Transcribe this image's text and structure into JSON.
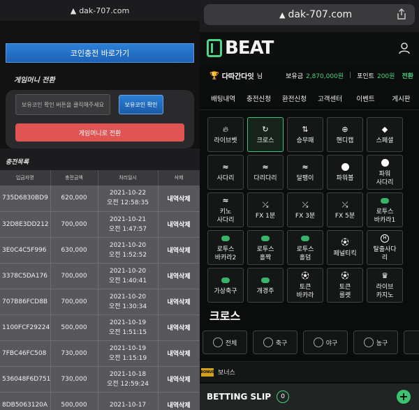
{
  "left": {
    "url": "dak-707.com",
    "coin_button": "코인충전 바로가기",
    "section_title": "게임머니 전환",
    "input_placeholder": "보유코인 확인 버튼을 클릭해주세요",
    "check_button": "보유코인 확인",
    "convert_button": "게임머니로 전환",
    "list_title": "충전목록",
    "columns": [
      "입금자명",
      "충전금액",
      "처리일시",
      "삭제"
    ],
    "rows": [
      {
        "id": "735D6830BD9",
        "amount": "620,000",
        "date": "2021-10-22",
        "time": "오전 12:58:35",
        "del": "내역삭제"
      },
      {
        "id": "32D8E3DD212",
        "amount": "700,000",
        "date": "2021-10-21",
        "time": "오전 1:47:57",
        "del": "내역삭제"
      },
      {
        "id": "3E0C4C5F996",
        "amount": "630,000",
        "date": "2021-10-20",
        "time": "오전 1:52:52",
        "del": "내역삭제"
      },
      {
        "id": "3378C5DA176",
        "amount": "700,000",
        "date": "2021-10-20",
        "time": "오전 1:40:41",
        "del": "내역삭제"
      },
      {
        "id": "707B86FCD8B",
        "amount": "700,000",
        "date": "2021-10-20",
        "time": "오전 1:30:34",
        "del": "내역삭제"
      },
      {
        "id": "1100FCF29224",
        "amount": "500,000",
        "date": "2021-10-19",
        "time": "오전 1:51:15",
        "del": "내역삭제"
      },
      {
        "id": "7FBC46FC508",
        "amount": "730,000",
        "date": "2021-10-19",
        "time": "오전 1:15:19",
        "del": "내역삭제"
      },
      {
        "id": "536048F6D751",
        "amount": "730,000",
        "date": "2021-10-18",
        "time": "오전 12:59:24",
        "del": "내역삭제"
      },
      {
        "id": "8DB5063120A",
        "amount": "500,000",
        "date": "2021-10-17",
        "time": "",
        "del": "내역삭제"
      }
    ]
  },
  "right": {
    "url": "dak-707.com",
    "logo_text": "BEAT",
    "user": {
      "name": "다따간다잇",
      "suffix": "님",
      "balance_label": "보유금",
      "balance": "2,870,000원",
      "points_label": "포인트",
      "points": "200원",
      "convert": "전환"
    },
    "tabs": [
      "배팅내역",
      "충전신청",
      "환전신청",
      "고객센터",
      "이벤트",
      "게시판"
    ],
    "games": [
      {
        "label": "라이브벳",
        "icon": "fire-icon"
      },
      {
        "label": "크로스",
        "icon": "refresh-icon"
      },
      {
        "label": "승무패",
        "icon": "arrows-icon"
      },
      {
        "label": "핸디캡",
        "icon": "plus-circle-icon"
      },
      {
        "label": "스페셜",
        "icon": "tag-icon"
      },
      {
        "label": "사다리",
        "icon": "ladder-icon"
      },
      {
        "label": "다리다리",
        "icon": "ladder-icon"
      },
      {
        "label": "달팽이",
        "icon": "ladder-icon"
      },
      {
        "label": "파워볼",
        "icon": "ball-icon"
      },
      {
        "label": "파워\n사다리",
        "icon": "ball-icon"
      },
      {
        "label": "키노\n사다리",
        "icon": "ladder-icon"
      },
      {
        "label": "FX 1분",
        "icon": "chart-icon"
      },
      {
        "label": "FX 3분",
        "icon": "chart-icon"
      },
      {
        "label": "FX 5분",
        "icon": "chart-icon"
      },
      {
        "label": "로투스\n바카라1",
        "icon": "green-ball-icon"
      },
      {
        "label": "로투스\n바카라2",
        "icon": "green-ball-icon"
      },
      {
        "label": "로투스\n홀짝",
        "icon": "green-ball-icon"
      },
      {
        "label": "로투스\n홀덤",
        "icon": "green-ball-icon"
      },
      {
        "label": "페널티킥",
        "icon": "soccer-icon"
      },
      {
        "label": "탈출사다\n리",
        "icon": "h-icon"
      },
      {
        "label": "가상축구",
        "icon": "green-ball-icon"
      },
      {
        "label": "개경주",
        "icon": "green-ball-icon"
      },
      {
        "label": "토큰\n바카라",
        "icon": "soccer-icon"
      },
      {
        "label": "토큰\n룰렛",
        "icon": "soccer-icon"
      },
      {
        "label": "라이브\n카지노",
        "icon": "crown-icon"
      }
    ],
    "active_game": 1,
    "cross_title": "크로스",
    "sports": [
      "전체",
      "축구",
      "야구",
      "농구",
      ""
    ],
    "bonus_logo": "BONUS",
    "bonus": "보너스",
    "slip_label": "BETTING SLIP",
    "slip_count": "0",
    "slip_add": "+"
  }
}
